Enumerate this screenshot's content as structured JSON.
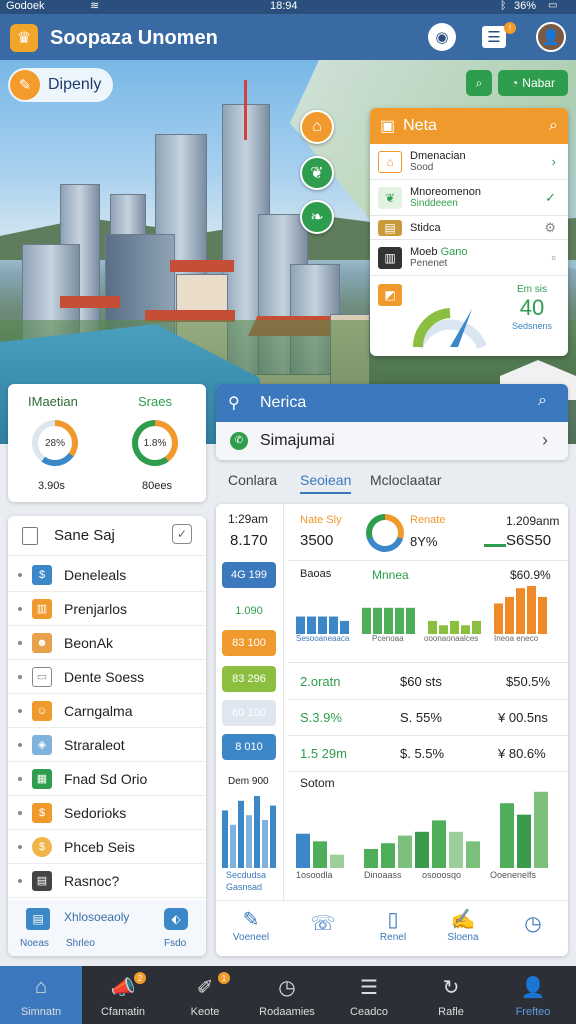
{
  "status_bar": {
    "carrier": "Godoek",
    "time": "18:94",
    "battery": "36%"
  },
  "header": {
    "title": "Soopaza Unomen"
  },
  "hero": {
    "badge_label": "Dipenly",
    "green_button_label": "Nabar"
  },
  "news": {
    "title": "Neta",
    "items": [
      {
        "title": "Dmenacian",
        "sub": "Sood"
      },
      {
        "title": "Mnoreomenon",
        "sub": "Sinddeeen"
      },
      {
        "title": "Stidca",
        "sub": ""
      },
      {
        "title": "Moeb",
        "sub": "Penenet",
        "tag": "Gano"
      },
      {
        "title": "",
        "sub": ""
      }
    ],
    "gauge_label": "Em sis",
    "gauge_value": "40",
    "gauge_sub": "Sedsnens"
  },
  "stats_card": {
    "left_title": "IMaetian",
    "left_ring": "28%",
    "left_value": "3.90s",
    "right_title": "Sraes",
    "right_ring": "1.8%",
    "right_value": "80ees"
  },
  "sidebar": {
    "header": "Sane Saj",
    "items": [
      {
        "label": "Deneleals"
      },
      {
        "label": "Prenjarlos"
      },
      {
        "label": "BeonAk"
      },
      {
        "label": "Dente Soess"
      },
      {
        "label": "Carngalma"
      },
      {
        "label": "Straraleot"
      },
      {
        "label": "Fnad Sd Orio"
      },
      {
        "label": "Sedorioks"
      },
      {
        "label": "Phceb Seis"
      },
      {
        "label": "Rasnoc?"
      }
    ],
    "footer_card": {
      "title": "Xhlosoeaoly",
      "left": "Noeas",
      "mid": "Shrleo",
      "right": "Fsdo"
    }
  },
  "search_panel": {
    "title": "Nerica",
    "search_value": "Simajumai"
  },
  "tabs": [
    {
      "label": "Conlara"
    },
    {
      "label": "Seoiean"
    },
    {
      "label": "Mcloclaatar"
    }
  ],
  "left_column": {
    "time": "1:29am",
    "value": "8.170",
    "levels": [
      "4G 199",
      "1.090",
      "83 100",
      "83 296",
      "60 100",
      "8 010"
    ],
    "chart_label": "Dem 900",
    "chart_sub": "Secdudsa",
    "chart_sub2": "Gasnsad",
    "chart_values": [
      12,
      9,
      14,
      11,
      15,
      10,
      13
    ],
    "chart_colors": [
      "#3b87c8",
      "#7fb3de",
      "#3b87c8",
      "#7fb3de",
      "#3b87c8",
      "#7fb3de",
      "#3b87c8"
    ]
  },
  "summary": {
    "c1_label": "Nate Sly",
    "c1_value": "3500",
    "c2_label": "Renate",
    "c2_value": "8Y%",
    "c3_label": "1.209anm",
    "c3_value": "S6S50"
  },
  "bar_groups": {
    "labels": [
      "Baoas",
      "Mnnea",
      "",
      ""
    ],
    "captions": [
      "Sesooaneaaca",
      "Pcenoaa",
      "ooonaonaalces",
      "Ineoa eneco"
    ],
    "top_value": "$60.9%",
    "values": [
      [
        8,
        8,
        8,
        8,
        6
      ],
      [
        12,
        12,
        12,
        12,
        12
      ],
      [
        6,
        4,
        6,
        4,
        6
      ],
      [
        14,
        17,
        21,
        22,
        17
      ]
    ],
    "colors": [
      "#3b87c8",
      "#4fae5a",
      "#8cbf3f",
      "#ef8a2a"
    ]
  },
  "rows": [
    {
      "a": "2.oratn",
      "b": "$60 sts",
      "c": "$50.5%"
    },
    {
      "a": "S.3.9%",
      "b": "S. 55%",
      "c": "¥ 00.5ns"
    },
    {
      "a": "1.5 29m",
      "b": "$. 5.5%",
      "c": "¥ 80.6%"
    }
  ],
  "bottom_chart": {
    "label": "Sotom",
    "captions": [
      "1osoodla",
      "Dinoaass",
      "osooosqo",
      "Ooenenelfs"
    ],
    "values": [
      18,
      14,
      7,
      0,
      10,
      13,
      17,
      19,
      25,
      19,
      14,
      0,
      34,
      28,
      40
    ],
    "colors": [
      "#3b87c8",
      "#4fae5a",
      "#9dcf9a",
      "#fff",
      "#4fae5a",
      "#4fae5a",
      "#7cbf7a",
      "#3b9b4c",
      "#4fae5a",
      "#9dcf9a",
      "#7cbf7a",
      "#fff",
      "#4fae5a",
      "#3b9b4c",
      "#7cbf7a"
    ],
    "max": 42
  },
  "action_icons": [
    {
      "label": "Voeneel"
    },
    {
      "label": ""
    },
    {
      "label": "Renel"
    },
    {
      "label": "Sloena"
    },
    {
      "label": ""
    }
  ],
  "bottom_nav": [
    {
      "label": "Simnatn"
    },
    {
      "label": "Cfamatin"
    },
    {
      "label": "Keote"
    },
    {
      "label": "Rodaamies"
    },
    {
      "label": "Ceadco"
    },
    {
      "label": "Rafle"
    },
    {
      "label": "Frefteo"
    }
  ],
  "colors": {
    "primary": "#3a6aa3",
    "accent": "#f09a2d",
    "green": "#2e9d4d",
    "nav": "#2c2f36"
  }
}
